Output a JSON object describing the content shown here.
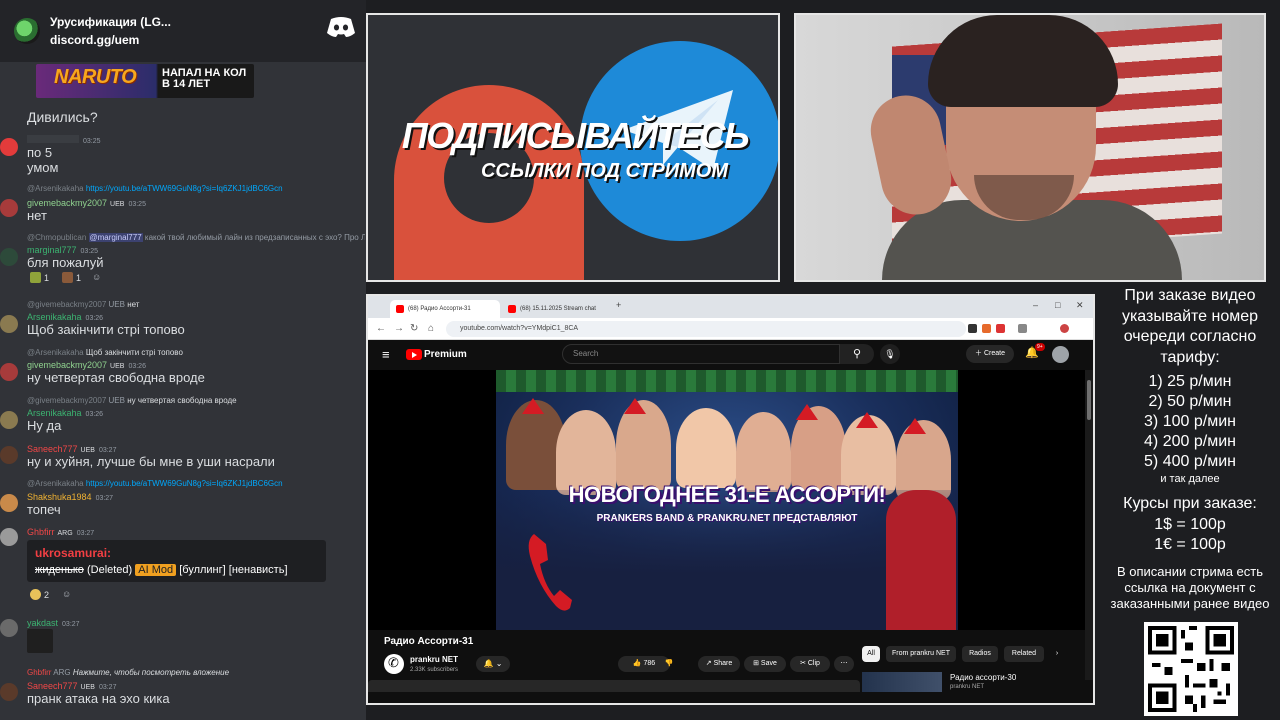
{
  "chat": {
    "server_name": "Урусификация (LG...",
    "server_link": "discord.gg/uem",
    "banner": {
      "left": "NARUTO",
      "right": "НАПАЛ НА КОЛ\nВ 14 ЛЕТ"
    },
    "messages": [
      {
        "text": "Дивились?"
      },
      {
        "time": "03:25",
        "text": "по 5"
      },
      {
        "text": "умом"
      },
      {
        "reply_user": "@Arsenikakaha",
        "reply_link": "https://youtu.be/aTWW69GuN8g?si=Iq6ZKJ1jdBC6Gcn",
        "user": "givemebackmy2007",
        "badge": "UEB",
        "time": "03:25",
        "text": "нет"
      },
      {
        "reply_user": "@Chmopublican",
        "reply_mention": "@marginal777",
        "reply_text": "какой твой любимый лайн из предзаписанных с эхо? Про Людми...",
        "user": "marginal777",
        "time": "03:25",
        "text": "бля пожалуй",
        "reactions": [
          "1",
          "1"
        ]
      },
      {
        "reply_user": "@givemebackmy2007",
        "reply_badge": "UEB",
        "reply_text": "нет",
        "user": "Arsenikakaha",
        "time": "03:26",
        "text": "Щоб закінчити стрі топово"
      },
      {
        "reply_user": "@Arsenikakaha",
        "reply_text": "Щоб закінчити стрі топово",
        "user": "givemebackmy2007",
        "badge": "UEB",
        "time": "03:26",
        "text": "ну четвертая свободна вроде"
      },
      {
        "reply_user": "@givemebackmy2007",
        "reply_badge": "UEB",
        "reply_text": "ну четвертая свободна вроде",
        "user": "Arsenikakaha",
        "time": "03:26",
        "text": "Ну да"
      },
      {
        "user": "Saneech777",
        "badge": "UEB",
        "time": "03:27",
        "text": "ну и хуйня, лучше бы мне в уши насрали"
      },
      {
        "reply_user": "@Arsenikakaha",
        "reply_link": "https://youtu.be/aTWW69GuN8g?si=Iq6ZKJ1jdBC6Gcn",
        "user": "Shakshuka1984",
        "time": "03:27",
        "text": "топеч"
      },
      {
        "user": "Ghbfirr",
        "badge": "ARG",
        "time": "03:27"
      },
      {
        "user": "yakdast",
        "time": "03:27"
      },
      {
        "reply_user": "Ghbfirr",
        "reply_badge": "ARG",
        "reply_text": "Нажмите, чтобы посмотреть вложение",
        "user": "Saneech777",
        "badge": "UEB",
        "time": "03:27",
        "text": "пранк атака на эхо кика"
      }
    ],
    "embed": {
      "author": "ukrosamurai:",
      "deleted_word": "жиденько",
      "deleted_tag": "(Deleted)",
      "mod_tag": "AI Mod",
      "tags": "[буллинг] [ненависть]"
    },
    "embed_reaction_count": "2"
  },
  "promo": {
    "title": "ПОДПИСЫВАЙТЕСЬ",
    "subtitle": "ССЫЛКИ ПОД СТРИМОМ"
  },
  "browser": {
    "tabs": [
      "(68) Радио Ассорти-31",
      "(68) 15.11.2025 Stream chat"
    ],
    "url": "youtube.com/watch?v=YMdpiC1_8CA",
    "yt": {
      "brand": "Premium",
      "search_placeholder": "Search",
      "create_label": "Create",
      "notif_count": "9+",
      "thumb_title": "НОВОГОДНЕЕ 31-Е АССОРТИ!",
      "thumb_sub": "PRANKERS BAND & PRANKRU.NET ПРЕДСТАВЛЯЮТ",
      "video_title": "Радио Ассорти-31",
      "channel": "prankru NET",
      "subscribers": "2.33K subscribers",
      "likes": "786",
      "share": "Share",
      "save": "Save",
      "clip": "Clip",
      "chips": [
        "All",
        "From prankru NET",
        "Radios",
        "Related"
      ],
      "rec_title": "Радио ассорти-30",
      "rec_channel": "prankru NET"
    }
  },
  "info": {
    "order_text": "При заказе видео указывайте номер очереди согласно тарифу:",
    "prices": [
      "1) 25 р/мин",
      "2) 50 р/мин",
      "3) 100 р/мин",
      "4) 200 р/мин",
      "5) 400 р/мин"
    ],
    "and_more": "и так далее",
    "rates_title": "Курсы при заказе:",
    "rates": [
      "1$ = 100р",
      "1€ = 100р"
    ],
    "desc": "В описании стрима есть ссылка на документ с заказанными ранее видео"
  }
}
